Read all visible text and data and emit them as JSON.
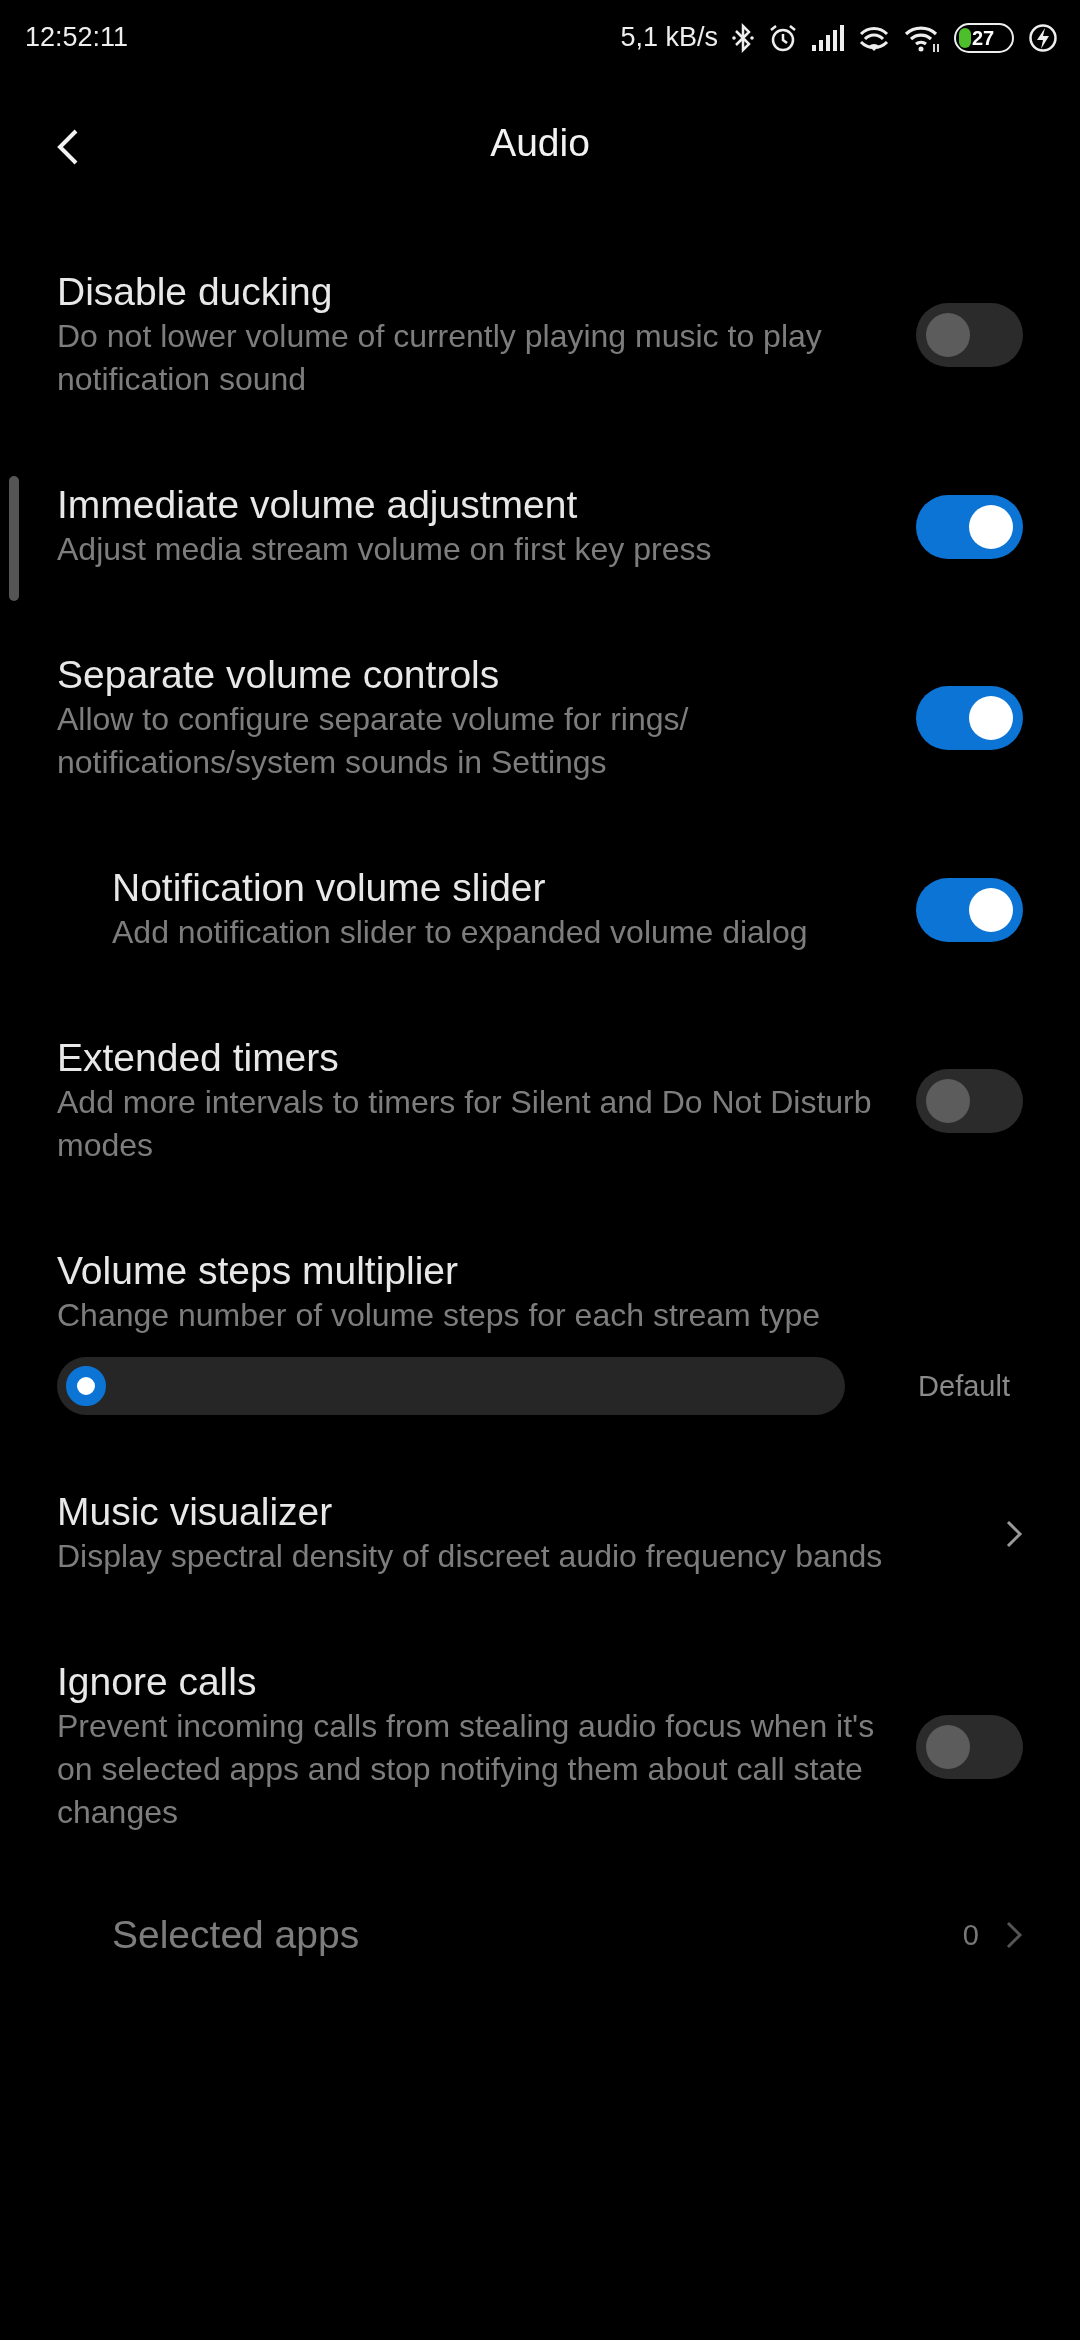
{
  "status_bar": {
    "time": "12:52:11",
    "network_speed": "5,1 kB/s",
    "battery": "27"
  },
  "header": {
    "title": "Audio"
  },
  "settings": [
    {
      "kind": "toggle",
      "title": "Disable ducking",
      "subtitle": "Do not lower volume of currently playing music to play notification sound",
      "on": false,
      "indented": false
    },
    {
      "kind": "toggle",
      "title": "Immediate volume adjustment",
      "subtitle": "Adjust media stream volume on first key press",
      "on": true,
      "indented": false
    },
    {
      "kind": "toggle",
      "title": "Separate volume controls",
      "subtitle": "Allow to configure separate volume for rings/ notifications/system sounds in Settings",
      "on": true,
      "indented": false
    },
    {
      "kind": "toggle",
      "title": "Notification volume slider",
      "subtitle": "Add notification slider to expanded volume dialog",
      "on": true,
      "indented": true
    },
    {
      "kind": "toggle",
      "title": "Extended timers",
      "subtitle": "Add more intervals to timers for Silent and Do Not Disturb modes",
      "on": false,
      "indented": false
    },
    {
      "kind": "slider",
      "title": "Volume steps multiplier",
      "subtitle": "Change number of volume steps for each stream type",
      "level": 0,
      "value_label": "Default",
      "indented": false
    },
    {
      "kind": "link",
      "title": "Music visualizer",
      "subtitle": "Display spectral density of discreet audio frequency bands",
      "indented": false
    },
    {
      "kind": "toggle",
      "title": "Ignore calls",
      "subtitle": "Prevent incoming calls from stealing audio focus when it's on selected apps and stop notifying them about call state changes",
      "on": false,
      "indented": false
    },
    {
      "kind": "count",
      "title": "Selected apps",
      "value": "0",
      "disabled": true,
      "indented": true
    }
  ]
}
